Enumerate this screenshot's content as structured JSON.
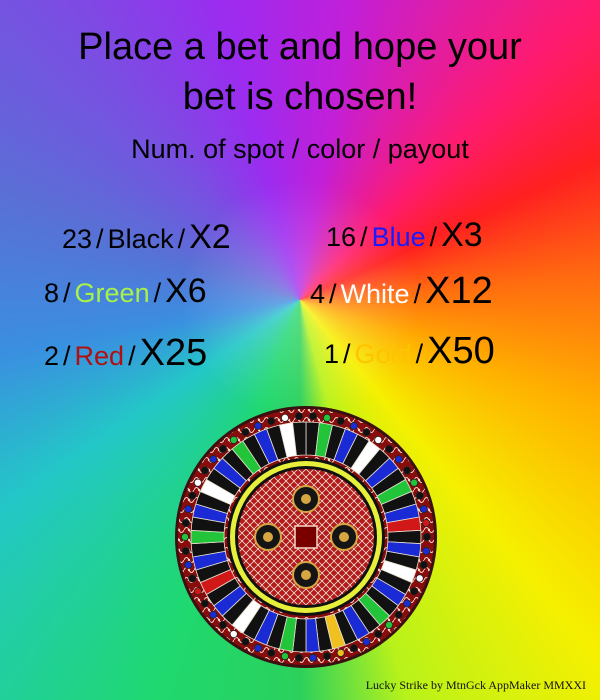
{
  "header": {
    "title_line1": "Place a bet and hope your",
    "title_line2": "bet is chosen!",
    "subtitle": "Num. of spot / color / payout"
  },
  "bets": [
    {
      "spots": "23",
      "color_name": "Black",
      "payout": "X2",
      "color": "#000000"
    },
    {
      "spots": "16",
      "color_name": "Blue",
      "payout": "X3",
      "color": "#1a1aff"
    },
    {
      "spots": "8",
      "color_name": "Green",
      "payout": "X6",
      "color": "#a8f04a"
    },
    {
      "spots": "4",
      "color_name": "White",
      "payout": "X12",
      "color": "#ffffff"
    },
    {
      "spots": "2",
      "color_name": "Red",
      "payout": "X25",
      "color": "#b01010"
    },
    {
      "spots": "1",
      "color_name": "Gold",
      "payout": "X50",
      "color": "#ffc400"
    }
  ],
  "separator": "/",
  "wheel": {
    "center_label": "Lucky Strike",
    "slot_colors": {
      "black": "#111111",
      "blue": "#1a2bd6",
      "green": "#22c43a",
      "white": "#ffffff",
      "red": "#d01818",
      "gold": "#f0c020"
    }
  },
  "footer": {
    "text": "Lucky Strike  by MtnGck  AppMaker  MMXXI"
  }
}
